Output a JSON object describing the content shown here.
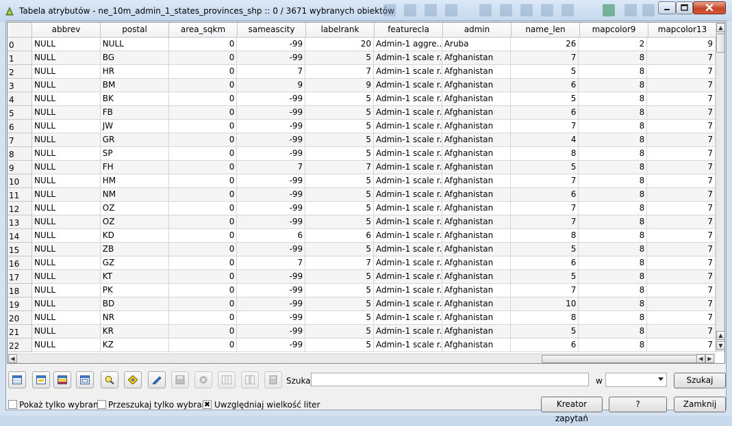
{
  "window": {
    "title": "Tabela atrybutów - ne_10m_admin_1_states_provinces_shp :: 0 / 3671 wybranych obiektów",
    "icon": "qgis-icon"
  },
  "table": {
    "columns": [
      "abbrev",
      "postal",
      "area_sqkm",
      "sameascity",
      "labelrank",
      "featurecla",
      "admin",
      "name_len",
      "mapcolor9",
      "mapcolor13"
    ],
    "rows": [
      [
        "0",
        "NULL",
        "NULL",
        "0",
        "-99",
        "20",
        "Admin-1 aggre...",
        "Aruba",
        "26",
        "2",
        "9"
      ],
      [
        "1",
        "NULL",
        "BG",
        "0",
        "-99",
        "5",
        "Admin-1 scale r...",
        "Afghanistan",
        "7",
        "8",
        "7"
      ],
      [
        "2",
        "NULL",
        "HR",
        "0",
        "7",
        "7",
        "Admin-1 scale r...",
        "Afghanistan",
        "5",
        "8",
        "7"
      ],
      [
        "3",
        "NULL",
        "BM",
        "0",
        "9",
        "9",
        "Admin-1 scale r...",
        "Afghanistan",
        "6",
        "8",
        "7"
      ],
      [
        "4",
        "NULL",
        "BK",
        "0",
        "-99",
        "5",
        "Admin-1 scale r...",
        "Afghanistan",
        "5",
        "8",
        "7"
      ],
      [
        "5",
        "NULL",
        "FB",
        "0",
        "-99",
        "5",
        "Admin-1 scale r...",
        "Afghanistan",
        "6",
        "8",
        "7"
      ],
      [
        "6",
        "NULL",
        "JW",
        "0",
        "-99",
        "5",
        "Admin-1 scale r...",
        "Afghanistan",
        "7",
        "8",
        "7"
      ],
      [
        "7",
        "NULL",
        "GR",
        "0",
        "-99",
        "5",
        "Admin-1 scale r...",
        "Afghanistan",
        "4",
        "8",
        "7"
      ],
      [
        "8",
        "NULL",
        "SP",
        "0",
        "-99",
        "5",
        "Admin-1 scale r...",
        "Afghanistan",
        "8",
        "8",
        "7"
      ],
      [
        "9",
        "NULL",
        "FH",
        "0",
        "7",
        "7",
        "Admin-1 scale r...",
        "Afghanistan",
        "5",
        "8",
        "7"
      ],
      [
        "10",
        "NULL",
        "HM",
        "0",
        "-99",
        "5",
        "Admin-1 scale r...",
        "Afghanistan",
        "7",
        "8",
        "7"
      ],
      [
        "11",
        "NULL",
        "NM",
        "0",
        "-99",
        "5",
        "Admin-1 scale r...",
        "Afghanistan",
        "6",
        "8",
        "7"
      ],
      [
        "12",
        "NULL",
        "OZ",
        "0",
        "-99",
        "5",
        "Admin-1 scale r...",
        "Afghanistan",
        "7",
        "8",
        "7"
      ],
      [
        "13",
        "NULL",
        "OZ",
        "0",
        "-99",
        "5",
        "Admin-1 scale r...",
        "Afghanistan",
        "7",
        "8",
        "7"
      ],
      [
        "14",
        "NULL",
        "KD",
        "0",
        "6",
        "6",
        "Admin-1 scale r...",
        "Afghanistan",
        "8",
        "8",
        "7"
      ],
      [
        "15",
        "NULL",
        "ZB",
        "0",
        "-99",
        "5",
        "Admin-1 scale r...",
        "Afghanistan",
        "5",
        "8",
        "7"
      ],
      [
        "16",
        "NULL",
        "GZ",
        "0",
        "7",
        "7",
        "Admin-1 scale r...",
        "Afghanistan",
        "6",
        "8",
        "7"
      ],
      [
        "17",
        "NULL",
        "KT",
        "0",
        "-99",
        "5",
        "Admin-1 scale r...",
        "Afghanistan",
        "5",
        "8",
        "7"
      ],
      [
        "18",
        "NULL",
        "PK",
        "0",
        "-99",
        "5",
        "Admin-1 scale r...",
        "Afghanistan",
        "7",
        "8",
        "7"
      ],
      [
        "19",
        "NULL",
        "BD",
        "0",
        "-99",
        "5",
        "Admin-1 scale r...",
        "Afghanistan",
        "10",
        "8",
        "7"
      ],
      [
        "20",
        "NULL",
        "NR",
        "0",
        "-99",
        "5",
        "Admin-1 scale r...",
        "Afghanistan",
        "8",
        "8",
        "7"
      ],
      [
        "21",
        "NULL",
        "KR",
        "0",
        "-99",
        "5",
        "Admin-1 scale r...",
        "Afghanistan",
        "5",
        "8",
        "7"
      ],
      [
        "22",
        "NULL",
        "KZ",
        "0",
        "-99",
        "5",
        "Admin-1 scale r...",
        "Afghanistan",
        "6",
        "8",
        "7"
      ]
    ]
  },
  "toolbar": {
    "icons": [
      "unselect-all-icon",
      "move-selection-to-top-icon",
      "invert-selection-icon",
      "copy-rows-icon",
      "zoom-to-selection-icon",
      "pan-to-selection-icon",
      "toggle-editing-icon",
      "save-edits-icon",
      "delete-selected-icon",
      "new-column-icon",
      "delete-column-icon",
      "field-calculator-icon"
    ],
    "search_label": "Szukaj",
    "search_value": "",
    "in_label": "w",
    "field_selected": "",
    "search_button": "Szukaj"
  },
  "bottom": {
    "show_selected_label": "Pokaż tylko wybrane",
    "show_selected_checked": false,
    "search_selected_label": "Przeszukaj tylko wybrane",
    "search_selected_checked": false,
    "case_sensitive_label": "Uwzględniaj wielkość liter",
    "case_sensitive_checked": true,
    "query_builder_button": "Kreator zapytań",
    "help_button": "?",
    "close_button": "Zamknij"
  }
}
